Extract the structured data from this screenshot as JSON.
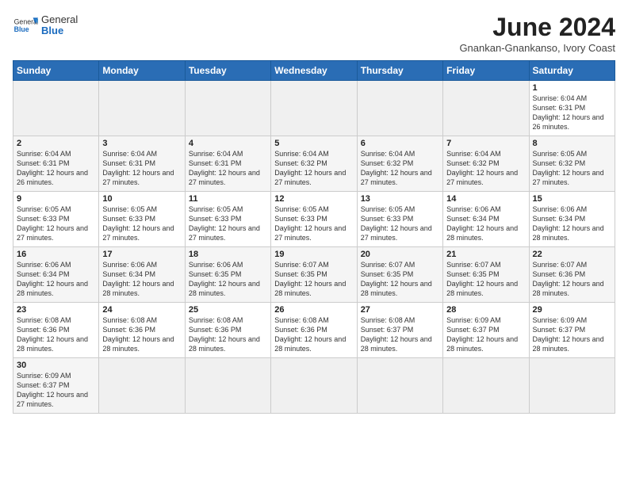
{
  "logo": {
    "text_general": "General",
    "text_blue": "Blue"
  },
  "title": "June 2024",
  "location": "Gnankan-Gnankanso, Ivory Coast",
  "days_of_week": [
    "Sunday",
    "Monday",
    "Tuesday",
    "Wednesday",
    "Thursday",
    "Friday",
    "Saturday"
  ],
  "weeks": [
    [
      {
        "day": "",
        "info": ""
      },
      {
        "day": "",
        "info": ""
      },
      {
        "day": "",
        "info": ""
      },
      {
        "day": "",
        "info": ""
      },
      {
        "day": "",
        "info": ""
      },
      {
        "day": "",
        "info": ""
      },
      {
        "day": "1",
        "info": "Sunrise: 6:04 AM\nSunset: 6:31 PM\nDaylight: 12 hours and 26 minutes."
      }
    ],
    [
      {
        "day": "2",
        "info": "Sunrise: 6:04 AM\nSunset: 6:31 PM\nDaylight: 12 hours and 26 minutes."
      },
      {
        "day": "3",
        "info": "Sunrise: 6:04 AM\nSunset: 6:31 PM\nDaylight: 12 hours and 27 minutes."
      },
      {
        "day": "4",
        "info": "Sunrise: 6:04 AM\nSunset: 6:31 PM\nDaylight: 12 hours and 27 minutes."
      },
      {
        "day": "5",
        "info": "Sunrise: 6:04 AM\nSunset: 6:32 PM\nDaylight: 12 hours and 27 minutes."
      },
      {
        "day": "6",
        "info": "Sunrise: 6:04 AM\nSunset: 6:32 PM\nDaylight: 12 hours and 27 minutes."
      },
      {
        "day": "7",
        "info": "Sunrise: 6:04 AM\nSunset: 6:32 PM\nDaylight: 12 hours and 27 minutes."
      },
      {
        "day": "8",
        "info": "Sunrise: 6:05 AM\nSunset: 6:32 PM\nDaylight: 12 hours and 27 minutes."
      }
    ],
    [
      {
        "day": "9",
        "info": "Sunrise: 6:05 AM\nSunset: 6:33 PM\nDaylight: 12 hours and 27 minutes."
      },
      {
        "day": "10",
        "info": "Sunrise: 6:05 AM\nSunset: 6:33 PM\nDaylight: 12 hours and 27 minutes."
      },
      {
        "day": "11",
        "info": "Sunrise: 6:05 AM\nSunset: 6:33 PM\nDaylight: 12 hours and 27 minutes."
      },
      {
        "day": "12",
        "info": "Sunrise: 6:05 AM\nSunset: 6:33 PM\nDaylight: 12 hours and 27 minutes."
      },
      {
        "day": "13",
        "info": "Sunrise: 6:05 AM\nSunset: 6:33 PM\nDaylight: 12 hours and 27 minutes."
      },
      {
        "day": "14",
        "info": "Sunrise: 6:06 AM\nSunset: 6:34 PM\nDaylight: 12 hours and 28 minutes."
      },
      {
        "day": "15",
        "info": "Sunrise: 6:06 AM\nSunset: 6:34 PM\nDaylight: 12 hours and 28 minutes."
      }
    ],
    [
      {
        "day": "16",
        "info": "Sunrise: 6:06 AM\nSunset: 6:34 PM\nDaylight: 12 hours and 28 minutes."
      },
      {
        "day": "17",
        "info": "Sunrise: 6:06 AM\nSunset: 6:34 PM\nDaylight: 12 hours and 28 minutes."
      },
      {
        "day": "18",
        "info": "Sunrise: 6:06 AM\nSunset: 6:35 PM\nDaylight: 12 hours and 28 minutes."
      },
      {
        "day": "19",
        "info": "Sunrise: 6:07 AM\nSunset: 6:35 PM\nDaylight: 12 hours and 28 minutes."
      },
      {
        "day": "20",
        "info": "Sunrise: 6:07 AM\nSunset: 6:35 PM\nDaylight: 12 hours and 28 minutes."
      },
      {
        "day": "21",
        "info": "Sunrise: 6:07 AM\nSunset: 6:35 PM\nDaylight: 12 hours and 28 minutes."
      },
      {
        "day": "22",
        "info": "Sunrise: 6:07 AM\nSunset: 6:36 PM\nDaylight: 12 hours and 28 minutes."
      }
    ],
    [
      {
        "day": "23",
        "info": "Sunrise: 6:08 AM\nSunset: 6:36 PM\nDaylight: 12 hours and 28 minutes."
      },
      {
        "day": "24",
        "info": "Sunrise: 6:08 AM\nSunset: 6:36 PM\nDaylight: 12 hours and 28 minutes."
      },
      {
        "day": "25",
        "info": "Sunrise: 6:08 AM\nSunset: 6:36 PM\nDaylight: 12 hours and 28 minutes."
      },
      {
        "day": "26",
        "info": "Sunrise: 6:08 AM\nSunset: 6:36 PM\nDaylight: 12 hours and 28 minutes."
      },
      {
        "day": "27",
        "info": "Sunrise: 6:08 AM\nSunset: 6:37 PM\nDaylight: 12 hours and 28 minutes."
      },
      {
        "day": "28",
        "info": "Sunrise: 6:09 AM\nSunset: 6:37 PM\nDaylight: 12 hours and 28 minutes."
      },
      {
        "day": "29",
        "info": "Sunrise: 6:09 AM\nSunset: 6:37 PM\nDaylight: 12 hours and 28 minutes."
      }
    ],
    [
      {
        "day": "30",
        "info": "Sunrise: 6:09 AM\nSunset: 6:37 PM\nDaylight: 12 hours and 27 minutes."
      },
      {
        "day": "",
        "info": ""
      },
      {
        "day": "",
        "info": ""
      },
      {
        "day": "",
        "info": ""
      },
      {
        "day": "",
        "info": ""
      },
      {
        "day": "",
        "info": ""
      },
      {
        "day": "",
        "info": ""
      }
    ]
  ],
  "colors": {
    "header_bg": "#2a6db5",
    "accent": "#1a6bbf"
  }
}
